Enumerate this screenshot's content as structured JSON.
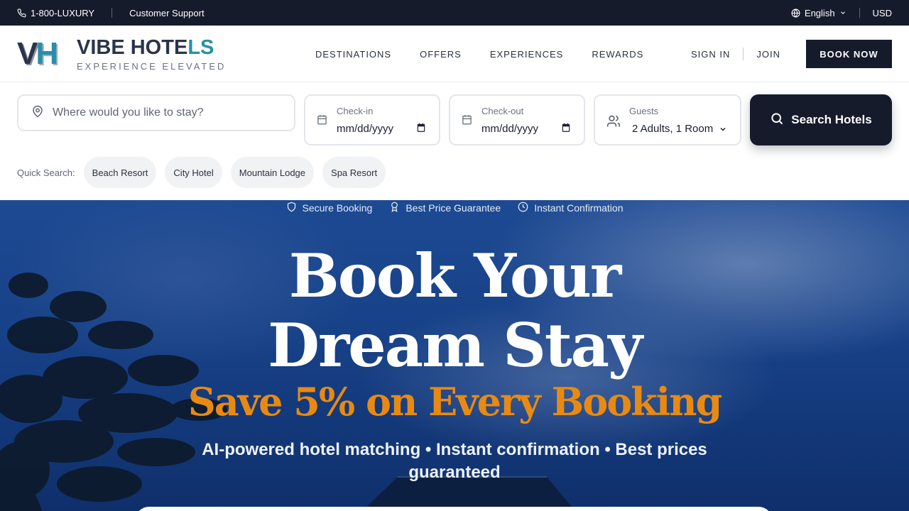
{
  "topbar": {
    "phone": "1-800-LUXURY",
    "support": "Customer Support",
    "language": "English",
    "currency": "USD"
  },
  "brand": {
    "mark_v": "V",
    "mark_h": "H",
    "name_a": "VIBE HOTE",
    "name_b": "LS",
    "tagline": "EXPERIENCE ELEVATED"
  },
  "nav": {
    "items": [
      "DESTINATIONS",
      "OFFERS",
      "EXPERIENCES",
      "REWARDS"
    ]
  },
  "auth": {
    "sign_in": "SIGN IN",
    "join": "JOIN",
    "book_now": "BOOK NOW"
  },
  "search": {
    "destination_placeholder": "Where would you like to stay?",
    "checkin_label": "Check-in",
    "checkin_value": "mm/dd/yyyy",
    "checkout_label": "Check-out",
    "checkout_value": "mm/dd/yyyy",
    "guests_label": "Guests",
    "guests_value": "2 Adults, 1 Room",
    "button": "Search Hotels",
    "quick_label": "Quick Search:",
    "quick_chips": [
      "Beach Resort",
      "City Hotel",
      "Mountain Lodge",
      "Spa Resort"
    ]
  },
  "hero": {
    "badges": [
      "Secure Booking",
      "Best Price Guarantee",
      "Instant Confirmation"
    ],
    "title_line1": "Book Your",
    "title_line2": "Dream Stay",
    "subtitle": "Save 5% on Every Booking",
    "description": "AI-powered hotel matching • Instant confirmation • Best prices guaranteed"
  },
  "colors": {
    "dark": "#151b2b",
    "teal": "#2a8ea6",
    "accent_orange": "#e88a12",
    "hero_blue": "#1d4a93"
  },
  "icons": {
    "phone": "phone-icon",
    "globe": "globe-icon",
    "chevron": "chevron-down-icon",
    "pin": "map-pin-icon",
    "calendar": "calendar-icon",
    "users": "users-icon",
    "search": "search-icon",
    "shield": "shield-icon",
    "award": "award-icon",
    "clock": "clock-icon"
  }
}
